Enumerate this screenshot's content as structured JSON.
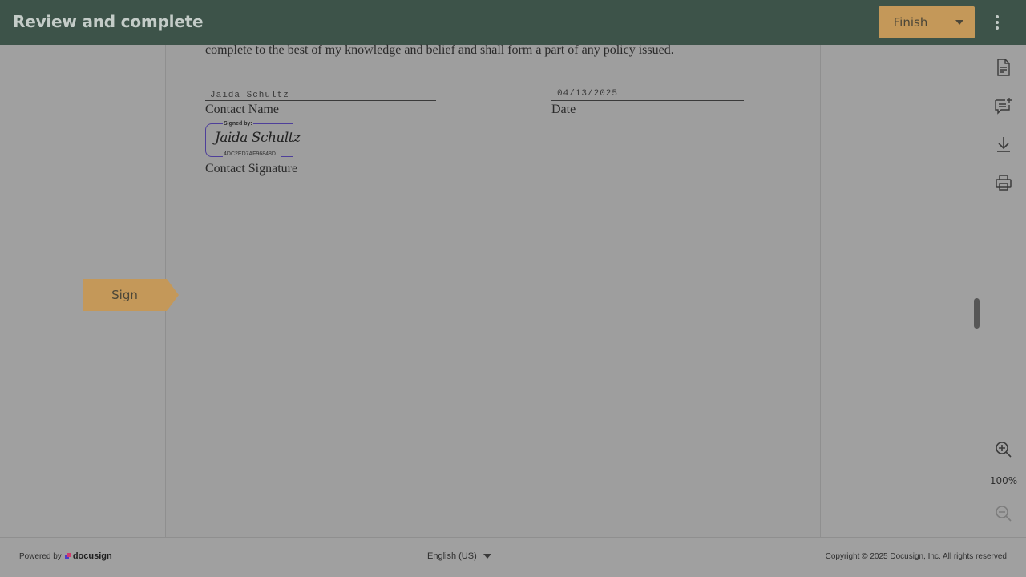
{
  "header": {
    "title": "Review and complete",
    "finish_label": "Finish"
  },
  "document": {
    "clause_text": "complete to the best of my knowledge and belief and shall form a part of any policy issued.",
    "contact_name_value": "Jaida Schultz",
    "contact_name_label": "Contact Name",
    "date_value": "04/13/2025",
    "date_label": "Date",
    "signature": {
      "signed_by": "Signed by:",
      "script": "Jaida Schultz",
      "hash": "4DC2ED7AF96848D..."
    },
    "contact_signature_label": "Contact Signature"
  },
  "sign_tag": {
    "label": "Sign"
  },
  "toolbar": {
    "icons": [
      "document-icon",
      "add-comment-icon",
      "download-icon",
      "print-icon"
    ],
    "zoom_level": "100%"
  },
  "footer": {
    "powered_by": "Powered by",
    "brand": "docusign",
    "language": "English (US)",
    "copyright": "Copyright © 2025 Docusign, Inc. All rights reserved"
  },
  "colors": {
    "header_bg": "#3d5349",
    "accent": "#c49859",
    "signature_frame": "#4e3f9a",
    "overlay_bg": "#a0a0a0"
  }
}
